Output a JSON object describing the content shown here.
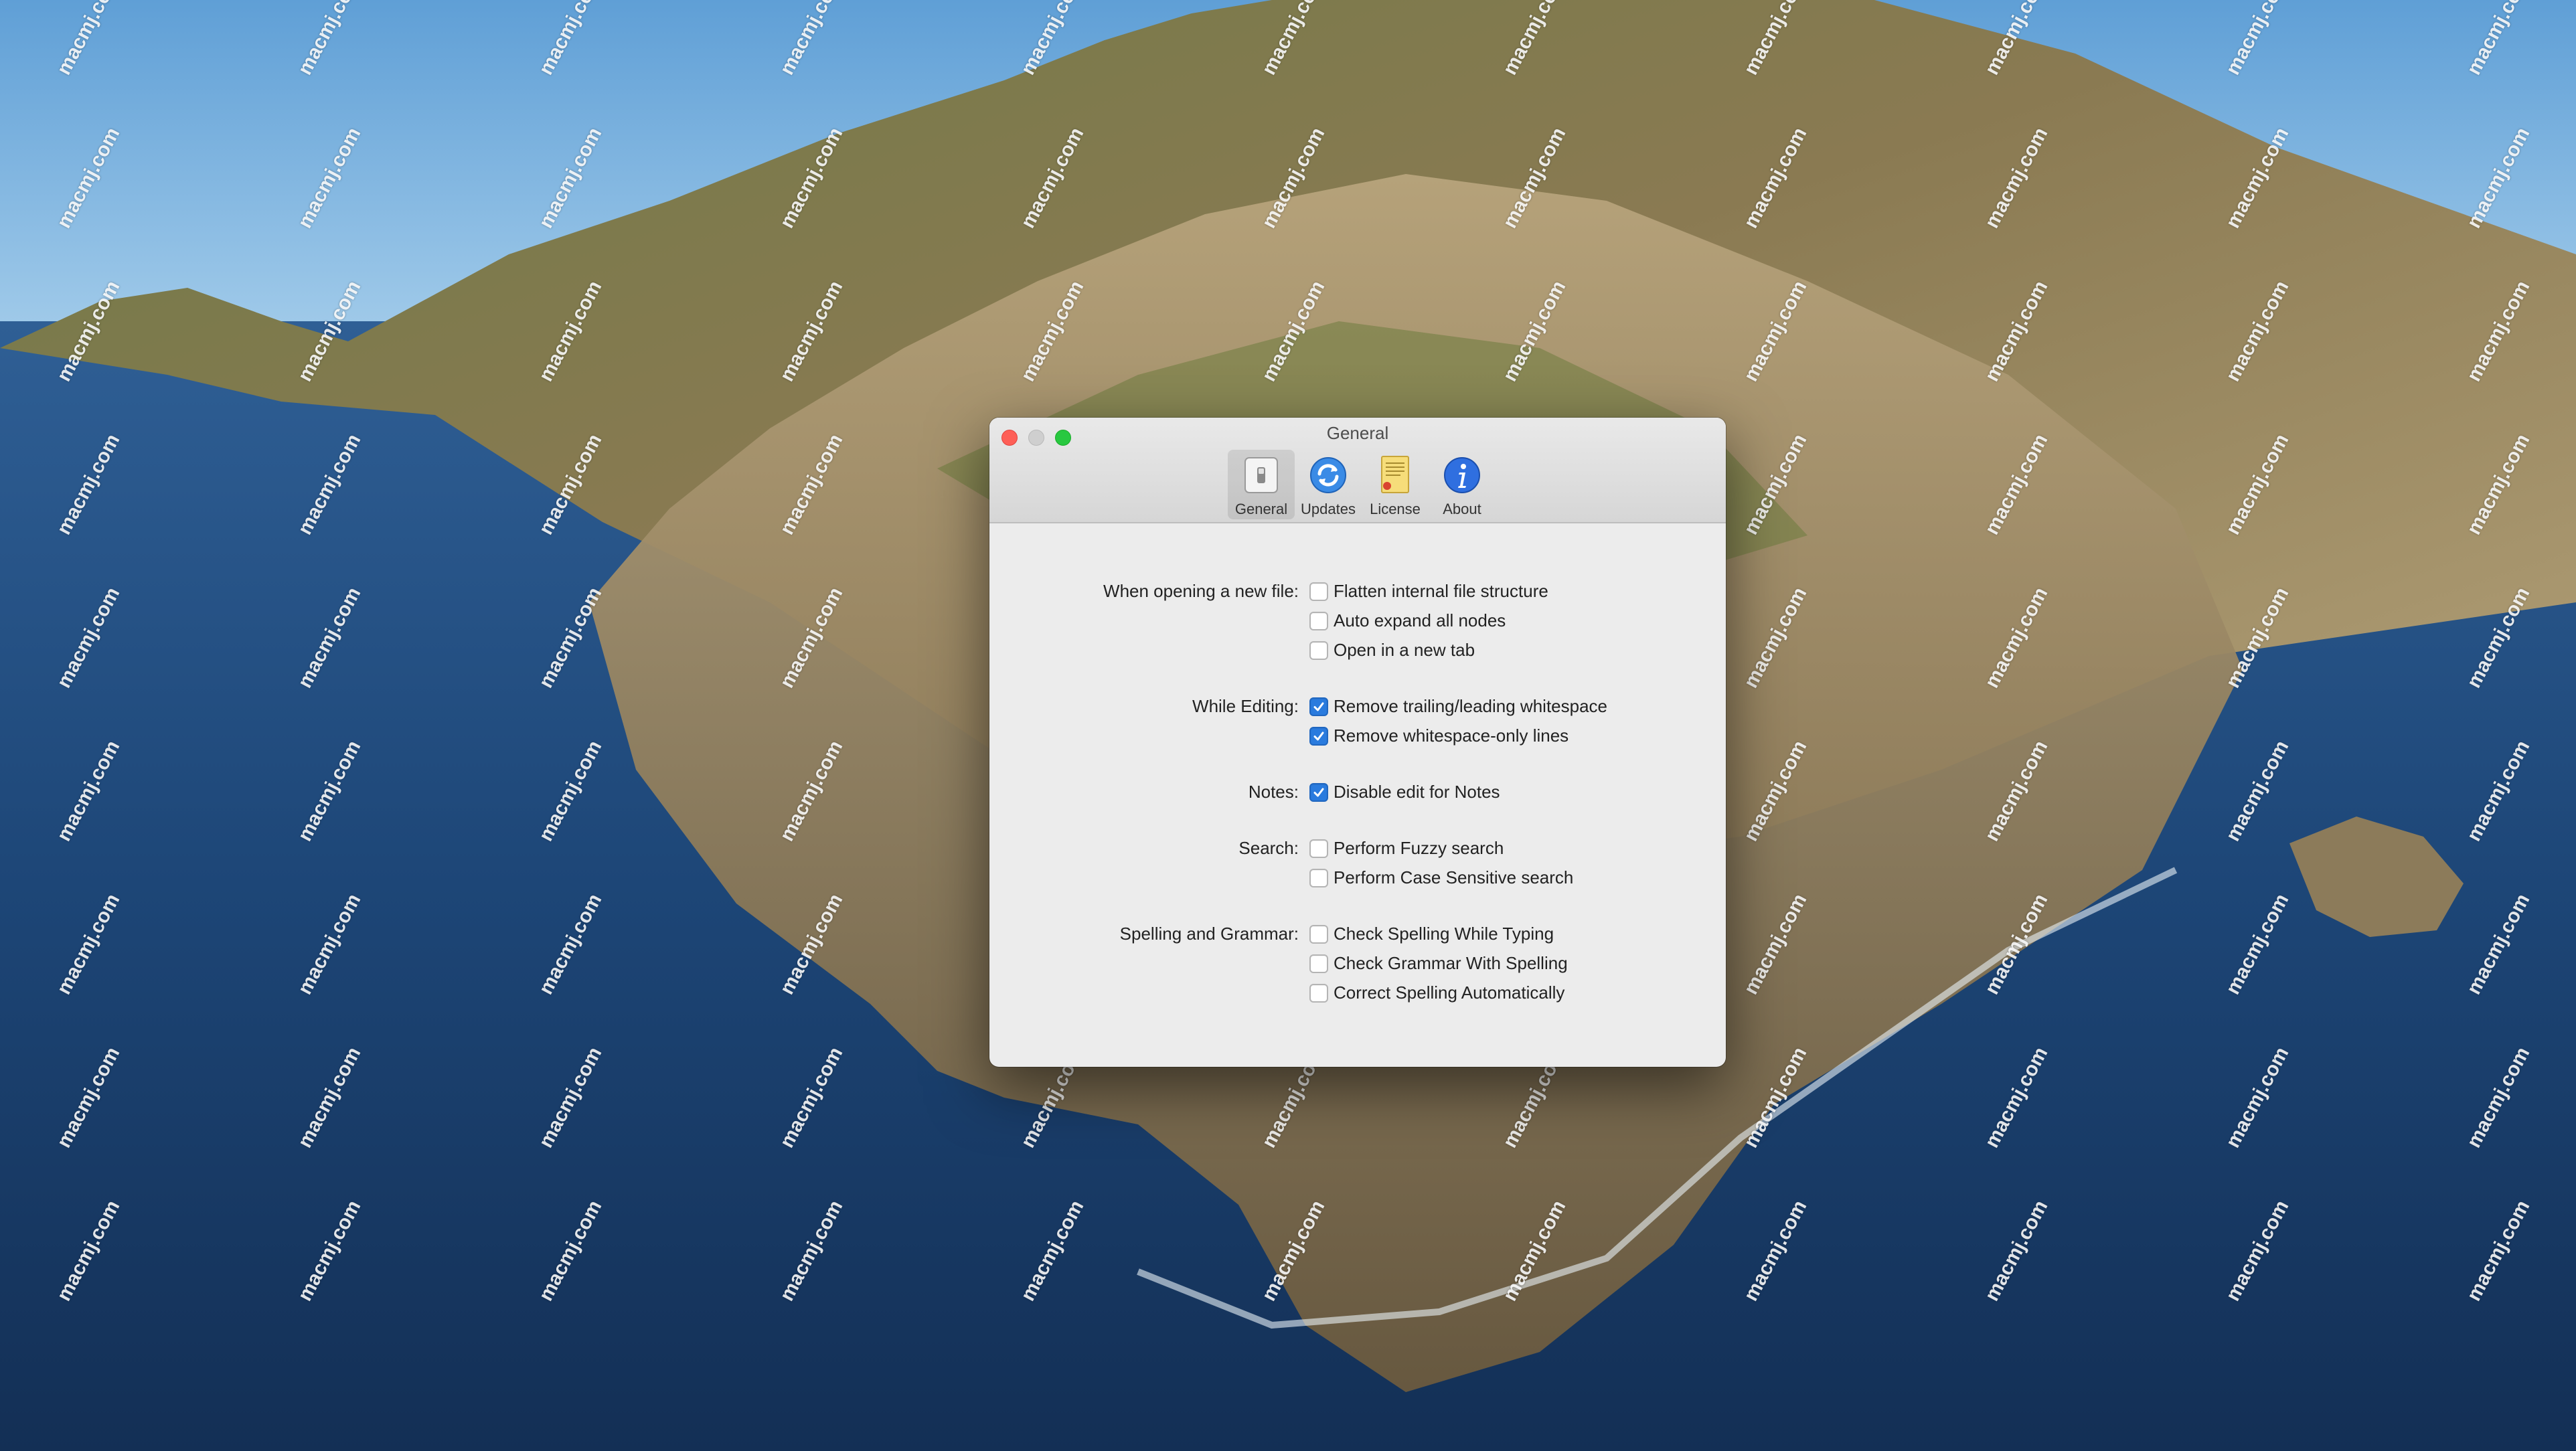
{
  "desktop": {
    "watermark_text": "macmj.com"
  },
  "window": {
    "title": "General",
    "toolbar": [
      {
        "label": "General",
        "icon": "general-switch-icon",
        "selected": true
      },
      {
        "label": "Updates",
        "icon": "updates-refresh-icon",
        "selected": false
      },
      {
        "label": "License",
        "icon": "license-certificate-icon",
        "selected": false
      },
      {
        "label": "About",
        "icon": "about-info-icon",
        "selected": false
      }
    ],
    "groups": [
      {
        "label": "When opening a new file:",
        "options": [
          {
            "label": "Flatten internal file structure",
            "checked": false
          },
          {
            "label": "Auto expand all nodes",
            "checked": false
          },
          {
            "label": "Open in a new tab",
            "checked": false
          }
        ]
      },
      {
        "label": "While Editing:",
        "options": [
          {
            "label": "Remove trailing/leading whitespace",
            "checked": true
          },
          {
            "label": "Remove whitespace-only lines",
            "checked": true
          }
        ]
      },
      {
        "label": "Notes:",
        "options": [
          {
            "label": "Disable edit for Notes",
            "checked": true
          }
        ]
      },
      {
        "label": "Search:",
        "options": [
          {
            "label": "Perform Fuzzy search",
            "checked": false
          },
          {
            "label": "Perform Case Sensitive search",
            "checked": false
          }
        ]
      },
      {
        "label": "Spelling and Grammar:",
        "options": [
          {
            "label": "Check Spelling While Typing",
            "checked": false
          },
          {
            "label": "Check Grammar With Spelling",
            "checked": false
          },
          {
            "label": "Correct Spelling Automatically",
            "checked": false
          }
        ]
      }
    ]
  },
  "colors": {
    "accent": "#2a7bde",
    "close": "#fe5f57",
    "zoom": "#28c840"
  }
}
